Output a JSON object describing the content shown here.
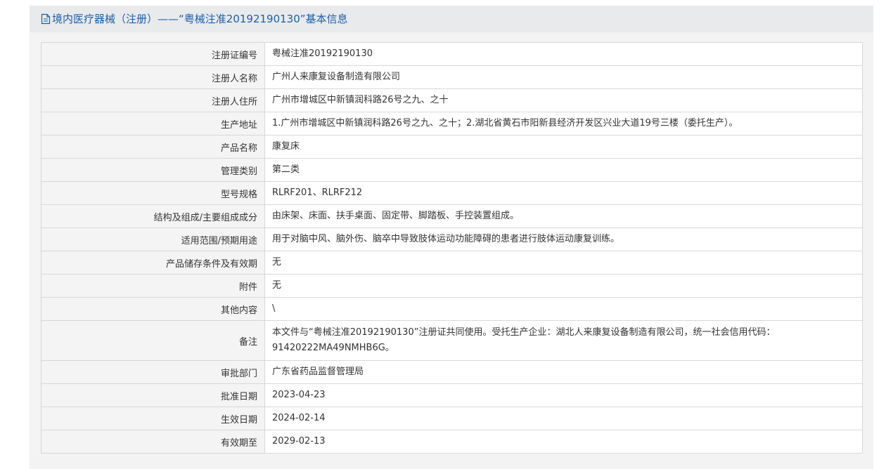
{
  "header": {
    "title": "境内医疗器械（注册）——“粤械注准20192190130”基本信息",
    "icon": "document-icon"
  },
  "rows": [
    {
      "label": "注册证编号",
      "value": "粤械注准20192190130"
    },
    {
      "label": "注册人名称",
      "value": "广州人来康复设备制造有限公司"
    },
    {
      "label": "注册人住所",
      "value": "广州市增城区中新镇润科路26号之九、之十"
    },
    {
      "label": "生产地址",
      "value": "1.广州市增城区中新镇润科路26号之九、之十；2.湖北省黄石市阳新县经济开发区兴业大道19号三楼（委托生产）。"
    },
    {
      "label": "产品名称",
      "value": "康复床"
    },
    {
      "label": "管理类别",
      "value": "第二类"
    },
    {
      "label": "型号规格",
      "value": "RLRF201、RLRF212"
    },
    {
      "label": "结构及组成/主要组成成分",
      "value": "由床架、床面、扶手桌面、固定带、脚踏板、手控装置组成。"
    },
    {
      "label": "适用范围/预期用途",
      "value": "用于对脑中风、脑外伤、脑卒中导致肢体运动功能障碍的患者进行肢体运动康复训练。"
    },
    {
      "label": "产品储存条件及有效期",
      "value": "无"
    },
    {
      "label": "附件",
      "value": "无"
    },
    {
      "label": "其他内容",
      "value": "\\"
    },
    {
      "label": "备注",
      "value": "本文件与“粤械注准20192190130”注册证共同使用。受托生产企业：湖北人来康复设备制造有限公司，统一社会信用代码：91420222MA49NMHB6G。"
    },
    {
      "label": "审批部门",
      "value": "广东省药品监督管理局"
    },
    {
      "label": "批准日期",
      "value": "2023-04-23"
    },
    {
      "label": "生效日期",
      "value": "2024-02-14"
    },
    {
      "label": "有效期至",
      "value": "2029-02-13"
    }
  ]
}
